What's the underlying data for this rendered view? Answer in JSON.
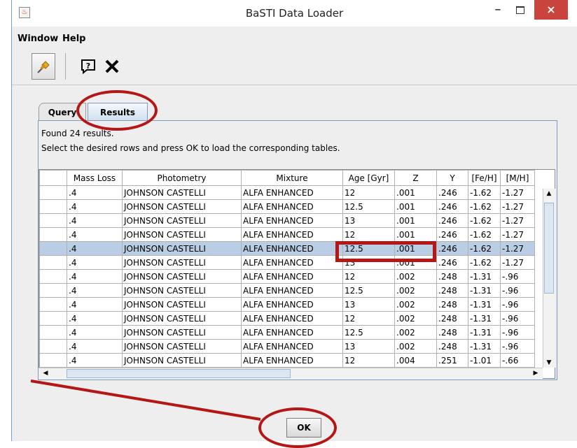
{
  "window": {
    "title": "BaSTI Data Loader",
    "icon": "java-cup-icon",
    "minimize": "–",
    "close": "×"
  },
  "menubar": {
    "items": [
      "Window",
      "Help"
    ]
  },
  "toolbar": {
    "buttons": [
      "pin-icon",
      "help-icon",
      "close-icon"
    ]
  },
  "tabs": [
    {
      "label": "Query"
    },
    {
      "label": "Results",
      "active": true
    }
  ],
  "results": {
    "found_text": "Found 24 results.",
    "instruction": "Select the desired rows and press OK to load the corresponding tables."
  },
  "table": {
    "columns": [
      "",
      "Mass Loss",
      "Photometry",
      "Mixture",
      "Age [Gyr]",
      "Z",
      "Y",
      "[Fe/H]",
      "[M/H]"
    ],
    "rows": [
      [
        ".4",
        "JOHNSON CASTELLI",
        "ALFA ENHANCED",
        "12",
        ".001",
        ".246",
        "-1.62",
        "-1.27"
      ],
      [
        ".4",
        "JOHNSON CASTELLI",
        "ALFA ENHANCED",
        "12.5",
        ".001",
        ".246",
        "-1.62",
        "-1.27"
      ],
      [
        ".4",
        "JOHNSON CASTELLI",
        "ALFA ENHANCED",
        "13",
        ".001",
        ".246",
        "-1.62",
        "-1.27"
      ],
      [
        ".4",
        "JOHNSON CASTELLI",
        "ALFA ENHANCED",
        "12",
        ".001",
        ".246",
        "-1.62",
        "-1.27"
      ],
      [
        ".4",
        "JOHNSON CASTELLI",
        "ALFA ENHANCED",
        "12.5",
        ".001",
        ".246",
        "-1.62",
        "-1.27"
      ],
      [
        ".4",
        "JOHNSON CASTELLI",
        "ALFA ENHANCED",
        "13",
        ".001",
        ".246",
        "-1.62",
        "-1.27"
      ],
      [
        ".4",
        "JOHNSON CASTELLI",
        "ALFA ENHANCED",
        "12",
        ".002",
        ".248",
        "-1.31",
        "-.96"
      ],
      [
        ".4",
        "JOHNSON CASTELLI",
        "ALFA ENHANCED",
        "12.5",
        ".002",
        ".248",
        "-1.31",
        "-.96"
      ],
      [
        ".4",
        "JOHNSON CASTELLI",
        "ALFA ENHANCED",
        "13",
        ".002",
        ".248",
        "-1.31",
        "-.96"
      ],
      [
        ".4",
        "JOHNSON CASTELLI",
        "ALFA ENHANCED",
        "12",
        ".002",
        ".248",
        "-1.31",
        "-.96"
      ],
      [
        ".4",
        "JOHNSON CASTELLI",
        "ALFA ENHANCED",
        "12.5",
        ".002",
        ".248",
        "-1.31",
        "-.96"
      ],
      [
        ".4",
        "JOHNSON CASTELLI",
        "ALFA ENHANCED",
        "13",
        ".002",
        ".248",
        "-1.31",
        "-.96"
      ],
      [
        ".4",
        "JOHNSON CASTELLI",
        "ALFA ENHANCED",
        "12",
        ".004",
        ".251",
        "-1.01",
        "-.66"
      ]
    ],
    "selected_row_index": 4
  },
  "ok_button": {
    "label": "OK"
  },
  "colors": {
    "annotation": "#b51616",
    "selection": "#b9cde5",
    "close_button": "#c9443c"
  }
}
